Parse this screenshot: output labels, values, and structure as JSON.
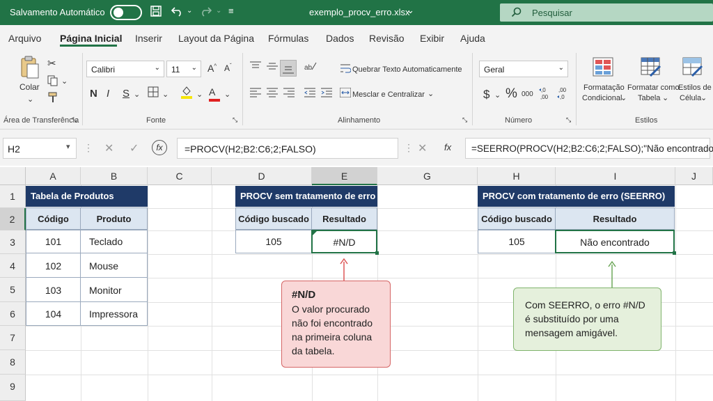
{
  "titlebar": {
    "autosave_label": "Salvamento Automático",
    "filename": "exemplo_procv_erro.xlsx",
    "filename_chevron": "⌄",
    "search_placeholder": "Pesquisar"
  },
  "menu": {
    "tabs": [
      "Arquivo",
      "Página Inicial",
      "Inserir",
      "Layout da Página",
      "Fórmulas",
      "Dados",
      "Revisão",
      "Exibir",
      "Ajuda"
    ],
    "active": "Página Inicial"
  },
  "ribbon": {
    "clipboard": {
      "paste_label": "Colar",
      "group_label": "Área de Transferência"
    },
    "font": {
      "name": "Calibri",
      "size": "11",
      "bold": "N",
      "italic": "I",
      "underline": "S",
      "group_label": "Fonte",
      "grow": "A^",
      "shrink": "Aˇ",
      "color_letter": "A"
    },
    "alignment": {
      "wrap": "Quebrar Texto Automaticamente",
      "merge": "Mesclar e Centralizar",
      "group_label": "Alinhamento"
    },
    "number": {
      "format": "Geral",
      "currency": "$",
      "percent": "%",
      "thousands": "000",
      "group_label": "Número"
    },
    "styles": {
      "conditional": "Formatação Condicional",
      "conditional_l1": "Formatação",
      "conditional_l2": "Condicional",
      "as_table_l1": "Formatar como",
      "as_table_l2": "Tabela",
      "cell_styles_l1": "Estilos de",
      "cell_styles_l2": "Célula",
      "group_label": "Estilos"
    }
  },
  "formula_bar": {
    "name_box": "H2",
    "formula_left": "=PROCV(H2;B2:C6;2;FALSO)",
    "formula_right": "=SEERRO(PROCV(H2;B2:C6;2;FALSO);\"Não encontrado\")",
    "fx": "fx"
  },
  "grid": {
    "columns": [
      "A",
      "B",
      "C",
      "D",
      "E",
      "G",
      "H",
      "I",
      "J"
    ],
    "rows": [
      "1",
      "2",
      "3",
      "4",
      "5",
      "6",
      "7",
      "8",
      "9"
    ]
  },
  "table_products": {
    "title": "Tabela de Produtos",
    "headers": [
      "Código",
      "Produto"
    ],
    "rows": [
      [
        "101",
        "Teclado"
      ],
      [
        "102",
        "Mouse"
      ],
      [
        "103",
        "Monitor"
      ],
      [
        "104",
        "Impressora"
      ]
    ]
  },
  "table_procv": {
    "title": "PROCV sem tratamento de erro",
    "headers": [
      "Código buscado",
      "Resultado"
    ],
    "row": [
      "105",
      "#N/D"
    ]
  },
  "table_seerro": {
    "title": "PROCV com tratamento de erro (SEERRO)",
    "headers": [
      "Código buscado",
      "Resultado"
    ],
    "row": [
      "105",
      "Não encontrado"
    ]
  },
  "callouts": {
    "red_title": "#N/D",
    "red_l1": "O valor procurado",
    "red_l2": "não foi encontrado",
    "red_l3": "na primeira coluna",
    "red_l4": "da tabela.",
    "green_l1": "Com SEERRO, o erro #N/D",
    "green_l2": "é substituído por uma",
    "green_l3": "mensagem amigável."
  },
  "colors": {
    "brand": "#217346",
    "header_dark": "#1f3a68",
    "subheader": "#dce6f1",
    "error_box": "#f9d7d7",
    "ok_box": "#e5f0dc"
  }
}
